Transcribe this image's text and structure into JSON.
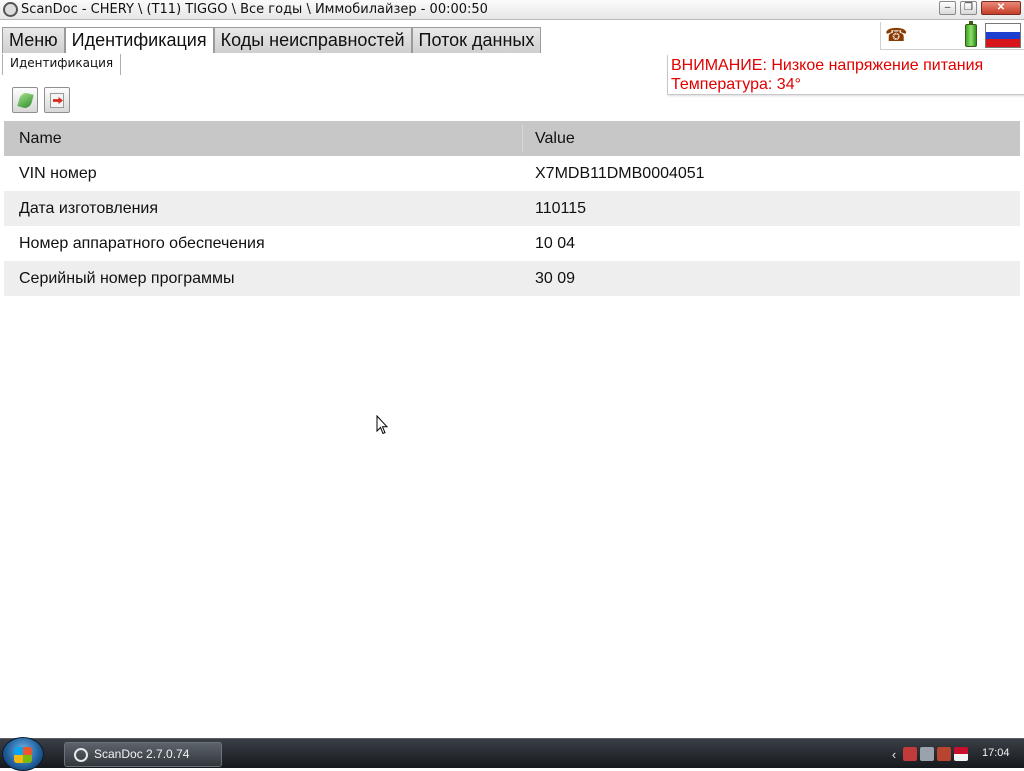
{
  "window": {
    "title": "ScanDoc - CHERY \\ (T11) TIGGO \\ Все годы \\ Иммобилайзер - 00:00:50",
    "minimize_label": "–",
    "maximize_label": "❐",
    "close_label": "✕"
  },
  "main_tabs": [
    {
      "label": "Меню"
    },
    {
      "label": "Идентификация"
    },
    {
      "label": "Коды неисправностей"
    },
    {
      "label": "Поток данных"
    }
  ],
  "status": {
    "phone_icon": "phone-icon",
    "battery_icon": "battery-icon",
    "flag_icon": "russia-flag-icon"
  },
  "warning": {
    "line1": "ВНИМАНИЕ: Низкое напряжение питания",
    "line2": "Температура: 34°",
    "color": "#e00000"
  },
  "sub_tab": {
    "label": "Идентификация"
  },
  "toolbar": {
    "refresh_icon": "leaf-icon",
    "export_icon": "export-icon"
  },
  "table": {
    "columns": [
      "Name",
      "Value"
    ],
    "rows": [
      {
        "name": "VIN номер",
        "value": "X7MDB11DMB0004051"
      },
      {
        "name": "Дата изготовления",
        "value": "110115"
      },
      {
        "name": "Номер аппаратного обеспечения",
        "value": "10 04"
      },
      {
        "name": "Серийный номер программы",
        "value": "30 09"
      }
    ]
  },
  "taskbar": {
    "task_label": "ScanDoc 2.7.0.74",
    "clock": "17:04",
    "tray_expand": "‹"
  }
}
